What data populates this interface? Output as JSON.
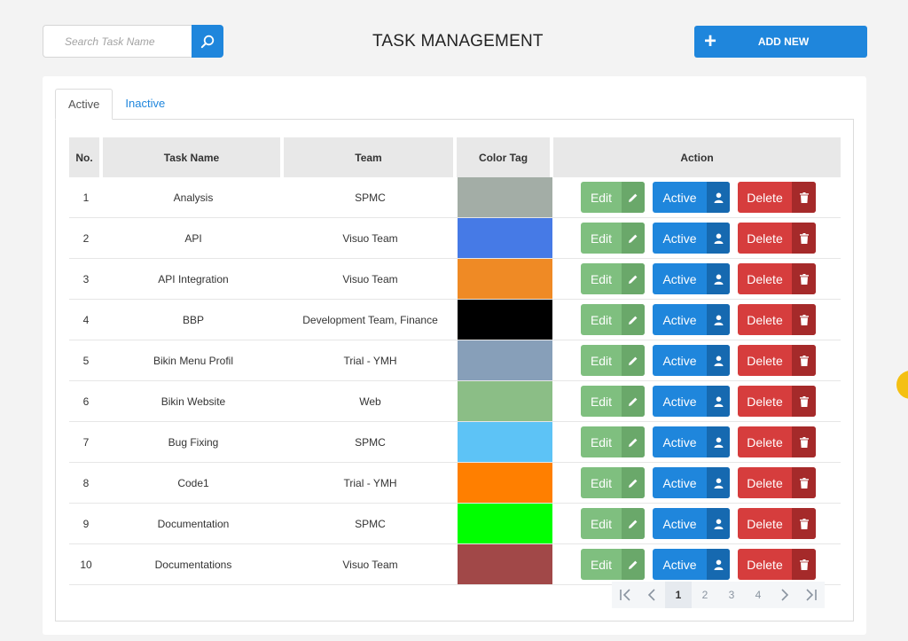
{
  "search": {
    "placeholder": "Search Task Name",
    "icon": "search-icon"
  },
  "header": {
    "title": "TASK MANAGEMENT",
    "add_new_label": "ADD NEW",
    "add_icon": "plus-icon"
  },
  "colors": {
    "primary": "#1f86dc",
    "edit": "#7fbf7f",
    "delete": "#d63d3d",
    "header_bg": "#e8e8e8"
  },
  "tabs": [
    {
      "label": "Active",
      "selected": true
    },
    {
      "label": "Inactive",
      "selected": false
    }
  ],
  "table": {
    "columns": [
      "No.",
      "Task Name",
      "Team",
      "Color Tag",
      "Action"
    ],
    "rows": [
      {
        "no": "1",
        "task": "Analysis",
        "team": "SPMC",
        "color": "#a3ada6"
      },
      {
        "no": "2",
        "task": "API",
        "team": "Visuo Team",
        "color": "#467ae6"
      },
      {
        "no": "3",
        "task": "API Integration",
        "team": "Visuo Team",
        "color": "#ef8a25"
      },
      {
        "no": "4",
        "task": "BBP",
        "team": "Development Team, Finance",
        "color": "#000000"
      },
      {
        "no": "5",
        "task": "Bikin Menu Profil",
        "team": "Trial - YMH",
        "color": "#879fb9"
      },
      {
        "no": "6",
        "task": "Bikin Website",
        "team": "Web",
        "color": "#8bbe86"
      },
      {
        "no": "7",
        "task": "Bug Fixing",
        "team": "SPMC",
        "color": "#5dc3f6"
      },
      {
        "no": "8",
        "task": "Code1",
        "team": "Trial - YMH",
        "color": "#ff7f00"
      },
      {
        "no": "9",
        "task": "Documentation",
        "team": "SPMC",
        "color": "#00ff00"
      },
      {
        "no": "10",
        "task": "Documentations",
        "team": "Visuo Team",
        "color": "#a14848"
      }
    ],
    "actions": {
      "edit_label": "Edit",
      "edit_icon": "pencil-icon",
      "active_label": "Active",
      "active_icon": "user-icon",
      "delete_label": "Delete",
      "delete_icon": "trash-icon"
    }
  },
  "pagination": {
    "first_icon": "first-page-icon",
    "prev_icon": "chevron-left-icon",
    "next_icon": "chevron-right-icon",
    "last_icon": "last-page-icon",
    "pages": [
      "1",
      "2",
      "3",
      "4"
    ],
    "current": "1"
  }
}
